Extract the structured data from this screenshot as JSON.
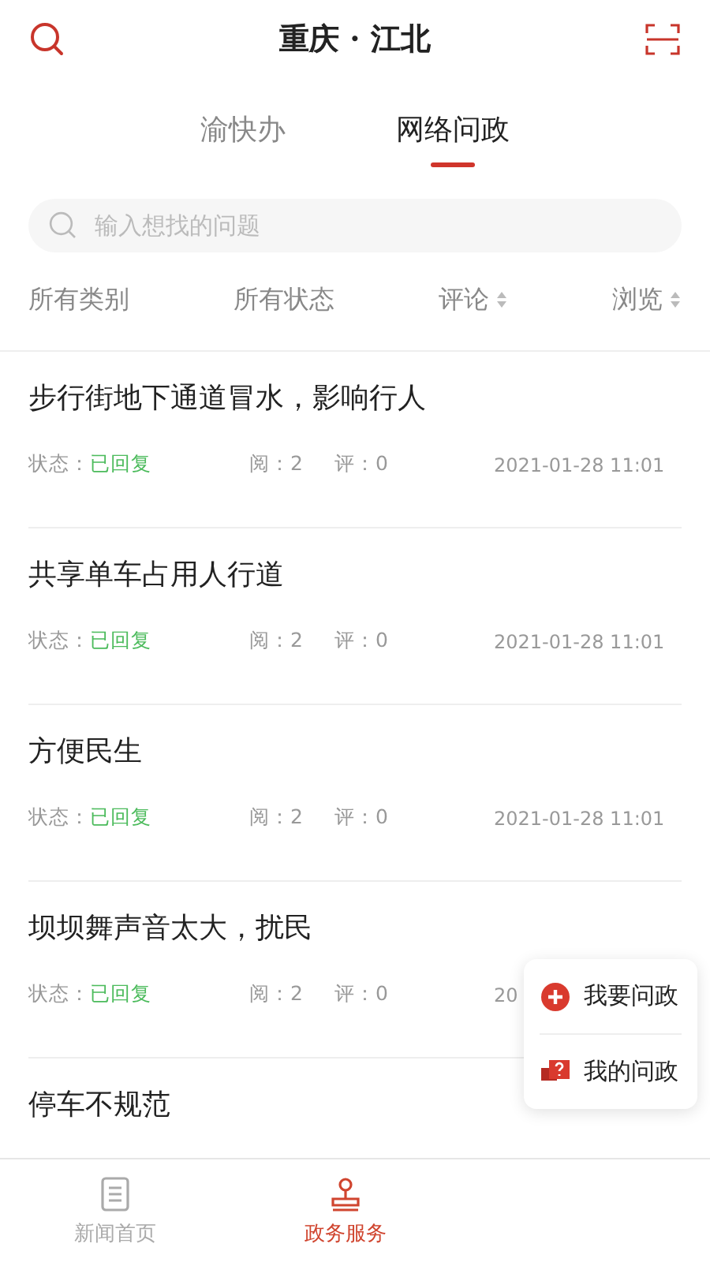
{
  "header": {
    "title": "重庆 · 江北"
  },
  "tabs": [
    {
      "label": "渝快办",
      "selected": false
    },
    {
      "label": "网络问政",
      "selected": true
    }
  ],
  "search": {
    "placeholder": "输入想找的问题"
  },
  "filters": [
    {
      "label": "所有类别",
      "kind": "plain"
    },
    {
      "label": "所有状态",
      "kind": "plain"
    },
    {
      "label": "评论",
      "kind": "sort"
    },
    {
      "label": "浏览",
      "kind": "sort"
    }
  ],
  "items": [
    {
      "title": "步行街地下通道冒水，影响行人",
      "status_label": "状态：",
      "status": "已回复",
      "reads": "阅：2",
      "comments": "评：0",
      "date": "2021-01-28  11:01"
    },
    {
      "title": "共享单车占用人行道",
      "status_label": "状态：",
      "status": "已回复",
      "reads": "阅：2",
      "comments": "评：0",
      "date": "2021-01-28  11:01"
    },
    {
      "title": "方便民生",
      "status_label": "状态：",
      "status": "已回复",
      "reads": "阅：2",
      "comments": "评：0",
      "date": "2021-01-28  11:01"
    },
    {
      "title": "坝坝舞声音太大，扰民",
      "status_label": "状态：",
      "status": "已回复",
      "reads": "阅：2",
      "comments": "评：0",
      "date": "20"
    },
    {
      "title": "停车不规范"
    }
  ],
  "float_menu": [
    {
      "label": "我要问政",
      "kind": "add"
    },
    {
      "label": "我的问政",
      "kind": "mine"
    }
  ],
  "bottom_nav": [
    {
      "label": "新闻首页",
      "kind": "news",
      "selected": false
    },
    {
      "label": "政务服务",
      "kind": "service",
      "selected": true
    }
  ]
}
